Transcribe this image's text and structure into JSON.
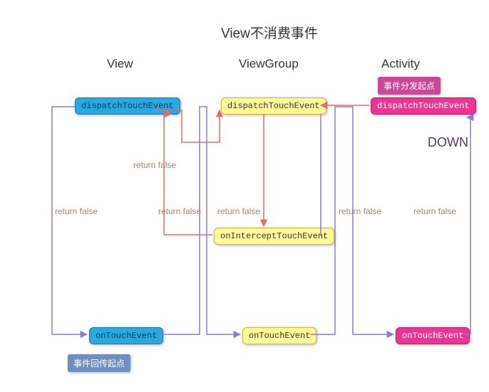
{
  "title": "View不消费事件",
  "columns": {
    "view": "View",
    "viewgroup": "ViewGroup",
    "activity": "Activity"
  },
  "tags": {
    "dispatch_start": "事件分发起点",
    "return_start": "事件回传起点"
  },
  "boxes": {
    "view_dispatch": "dispatchTouchEvent",
    "view_ontouch": "onTouchEvent",
    "vg_dispatch": "dispatchTouchEvent",
    "vg_intercept": "onInterceptTouchEvent",
    "vg_ontouch": "onTouchEvent",
    "act_dispatch": "dispatchTouchEvent",
    "act_ontouch": "onTouchEvent"
  },
  "labels": {
    "rf1": "return false",
    "rf2": "return false",
    "rf3": "return false",
    "rf4": "return false",
    "rf5": "return false",
    "rf6": "return false",
    "down": "DOWN"
  },
  "chart_data": {
    "type": "diagram",
    "description": "Android touch event dispatch flow when View does not consume event",
    "columns": [
      "View",
      "ViewGroup",
      "Activity"
    ],
    "nodes": [
      {
        "id": "act_dispatch",
        "col": "Activity",
        "label": "dispatchTouchEvent",
        "color": "pink",
        "tag": "事件分发起点"
      },
      {
        "id": "vg_dispatch",
        "col": "ViewGroup",
        "label": "dispatchTouchEvent",
        "color": "yellow"
      },
      {
        "id": "vg_intercept",
        "col": "ViewGroup",
        "label": "onInterceptTouchEvent",
        "color": "yellow"
      },
      {
        "id": "view_dispatch",
        "col": "View",
        "label": "dispatchTouchEvent",
        "color": "cyan"
      },
      {
        "id": "view_ontouch",
        "col": "View",
        "label": "onTouchEvent",
        "color": "cyan",
        "tag": "事件回传起点"
      },
      {
        "id": "vg_ontouch",
        "col": "ViewGroup",
        "label": "onTouchEvent",
        "color": "yellow"
      },
      {
        "id": "act_ontouch",
        "col": "Activity",
        "label": "onTouchEvent",
        "color": "pink"
      }
    ],
    "edges": [
      {
        "from": "act_dispatch",
        "to": "vg_dispatch",
        "color": "red",
        "label": ""
      },
      {
        "from": "vg_dispatch",
        "to": "vg_intercept",
        "color": "red",
        "label": ""
      },
      {
        "from": "vg_intercept",
        "to": "view_dispatch",
        "color": "red",
        "label": "return false"
      },
      {
        "from": "view_dispatch",
        "to": "view_ontouch",
        "color": "purple",
        "label": ""
      },
      {
        "from": "view_ontouch",
        "to": "vg_ontouch",
        "color": "purple",
        "label": "return false"
      },
      {
        "from": "vg_ontouch",
        "to": "act_ontouch",
        "color": "purple",
        "label": "return false"
      },
      {
        "from": "act_ontouch",
        "to": "act_dispatch",
        "color": "purple",
        "label": "return false"
      },
      {
        "from": "view_dispatch",
        "to": "vg_dispatch",
        "color": "red",
        "label": "return false"
      },
      {
        "from": "vg_dispatch",
        "to": "act_dispatch",
        "color": "purple",
        "label": "return false"
      }
    ],
    "phase": "DOWN"
  }
}
